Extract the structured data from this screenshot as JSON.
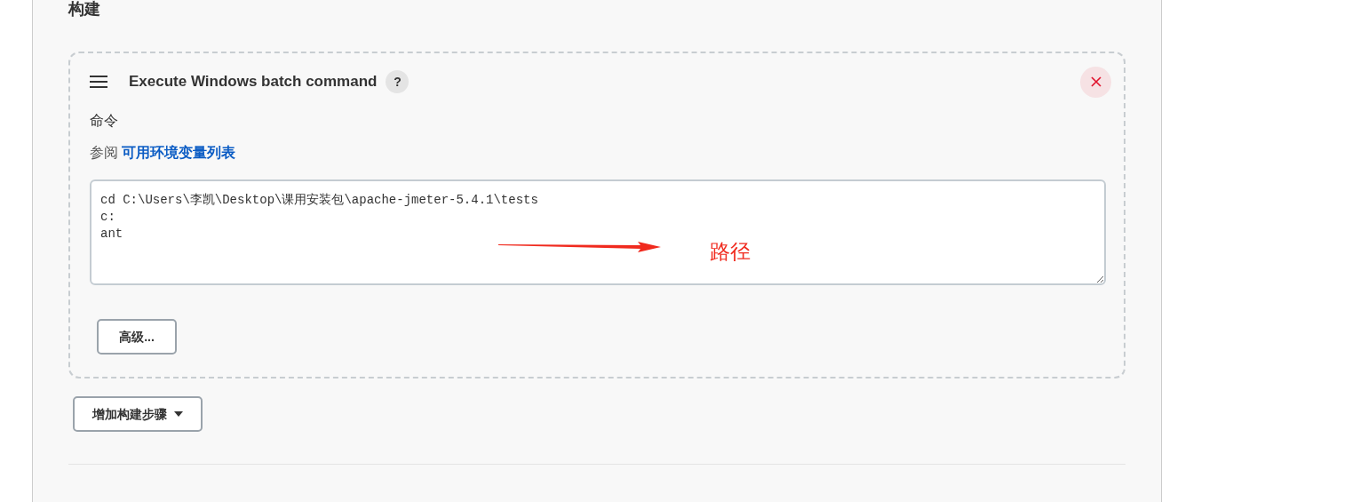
{
  "section_title": "构建",
  "build_step": {
    "title": "Execute Windows batch command",
    "help": "?",
    "field_label": "命令",
    "hint_prefix": "参阅",
    "hint_link": "可用环境变量列表",
    "command": "cd C:\\Users\\李凯\\Desktop\\课用安装包\\apache-jmeter-5.4.1\\tests\nc:\nant",
    "advanced_button": "高级..."
  },
  "annotation": {
    "text": "路径"
  },
  "add_step_button": "增加构建步骤"
}
